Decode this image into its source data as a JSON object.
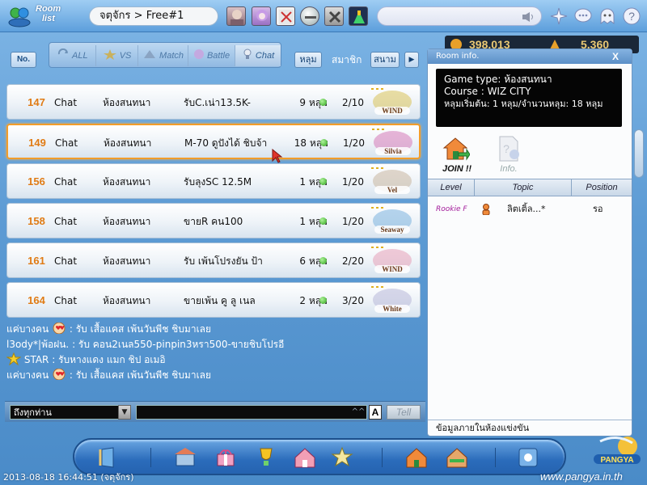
{
  "topbar": {
    "roomlist_label_1": "Room",
    "roomlist_label_2": "list",
    "channel": "จตุจักร > Free#1"
  },
  "filters": {
    "no_label": "No.",
    "tabs": [
      "ALL",
      "VS",
      "Match",
      "Battle",
      "Chat"
    ],
    "active_tab": "Chat",
    "pill_1": "หลุม",
    "label_member": "สมาชิก",
    "pill_2": "สนาม",
    "next_arrow": "▶"
  },
  "counters": {
    "value_1": "398,013",
    "value_2": "5,360"
  },
  "rooms": [
    {
      "num": "147",
      "mode": "Chat",
      "type": "ห้องสนทนา",
      "topic": "รับC.เน่า13.5K-",
      "holes": "9 หลุม",
      "players": "2/10",
      "course": "WIND",
      "selected": false
    },
    {
      "num": "149",
      "mode": "Chat",
      "type": "ห้องสนทนา",
      "topic": "M-70 ดูปังได้ ชิบจ้า",
      "holes": "18 หลุม",
      "players": "1/20",
      "course": "Silvia",
      "selected": true
    },
    {
      "num": "156",
      "mode": "Chat",
      "type": "ห้องสนทนา",
      "topic": "รับลุงSC 12.5M",
      "holes": "1 หลุม",
      "players": "1/20",
      "course": "Vel",
      "selected": false
    },
    {
      "num": "158",
      "mode": "Chat",
      "type": "ห้องสนทนา",
      "topic": "ขายR คน100",
      "holes": "1 หลุม",
      "players": "1/20",
      "course": "Seaway",
      "selected": false
    },
    {
      "num": "161",
      "mode": "Chat",
      "type": "ห้องสนทนา",
      "topic": "รับ เพ้นโปรงยัน ป้า",
      "holes": "6 หลุม",
      "players": "2/20",
      "course": "WIND",
      "selected": false
    },
    {
      "num": "164",
      "mode": "Chat",
      "type": "ห้องสนทนา",
      "topic": "ขายเพ้น คู ลู เนล",
      "holes": "2 หลุม",
      "players": "3/20",
      "course": "White",
      "selected": false
    }
  ],
  "chat": [
    {
      "name": "แค่บางคน",
      "icon": "heart",
      "text": " : รับ เสื้อแคส เพ้นวันพีช ชิบมาเลย"
    },
    {
      "name": "l3ody*|พ้อฝน.",
      "icon": "",
      "text": " : รับ คอน2เนล550-pinpin3หรา500-ขายชิบโปรอี"
    },
    {
      "name": "STAR",
      "icon": "star",
      "text": " : รับหางแดง แมก ชิป อเมอิ"
    },
    {
      "name": "แค่บางคน",
      "icon": "heart",
      "text": " : รับ เสื้อแคส เพ้นวันพีช ชิบมาเลย"
    }
  ],
  "chat_input": {
    "target": "ถึงทุกท่าน",
    "caret": "^^",
    "a_label": "A",
    "tell_label": "Tell",
    "arrow": "▼"
  },
  "room_info": {
    "title": "Room info.",
    "close": "X",
    "game_type": "Game type: ห้องสนทนา",
    "course": "Course : WIZ CITY",
    "holes_line": "หลุมเริ่มต้น: 1 หลุม/จำนวนหลุม: 18 หลุม",
    "join_label": "JOIN !!",
    "info_label": "Info.",
    "headers": [
      "Level",
      "Topic",
      "Position"
    ],
    "player": {
      "level": "Rookie F",
      "name": "ลิตเติ้ล...*",
      "position": "รอ"
    },
    "footer": "ข้อมูลภายในห้องแข่งขัน"
  },
  "footer": {
    "timestamp": "2013-08-18 16:44:51 (จตุจักร)",
    "url": "www.pangya.in.th"
  },
  "colors": {
    "accent_orange": "#f29d2a",
    "room_number": "#e07b14",
    "online_dot": "#2ea51b",
    "level_text": "#a21a9a"
  }
}
